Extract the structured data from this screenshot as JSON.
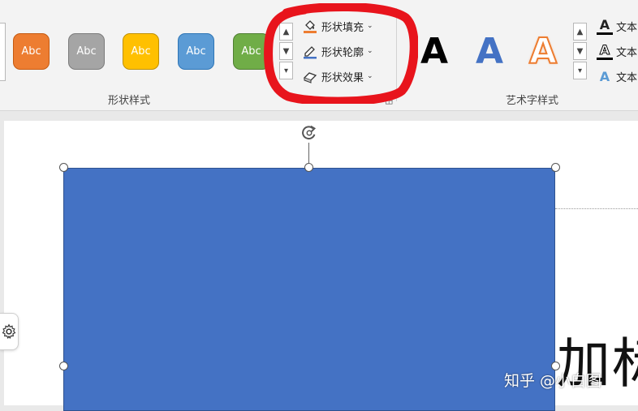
{
  "ribbon": {
    "shape_styles_label": "形状样式",
    "wordart_styles_label": "艺术字样式",
    "preset_label": "Abc",
    "presets": [
      {
        "color": "#ed7d31",
        "border": "#c55a11"
      },
      {
        "color": "#a5a5a5",
        "border": "#7b7b7b"
      },
      {
        "color": "#ffc000",
        "border": "#bf9000"
      },
      {
        "color": "#5b9bd5",
        "border": "#2e75b6"
      },
      {
        "color": "#70ad47",
        "border": "#507e32"
      }
    ],
    "commands": {
      "shape_fill": "形状填充",
      "shape_outline": "形状轮廓",
      "shape_effects": "形状效果"
    },
    "wordart": {
      "letter": "A",
      "styles": [
        "black",
        "blue",
        "orange-outline"
      ]
    },
    "text_commands": {
      "text_fill": "文本",
      "text_outline": "文本",
      "text_effects": "文本"
    },
    "icons": {
      "scroll_up": "up-arrow",
      "scroll_down": "down-arrow",
      "more": "more-icon",
      "dialog_launcher": "dialog-launcher-icon",
      "rotate": "rotate-icon",
      "settings": "gear-icon"
    }
  },
  "slide": {
    "shape_color": "#4472c4",
    "title_text": "加标",
    "watermark": "知乎 @小白图"
  },
  "annotation": {
    "color": "#e8141c"
  }
}
